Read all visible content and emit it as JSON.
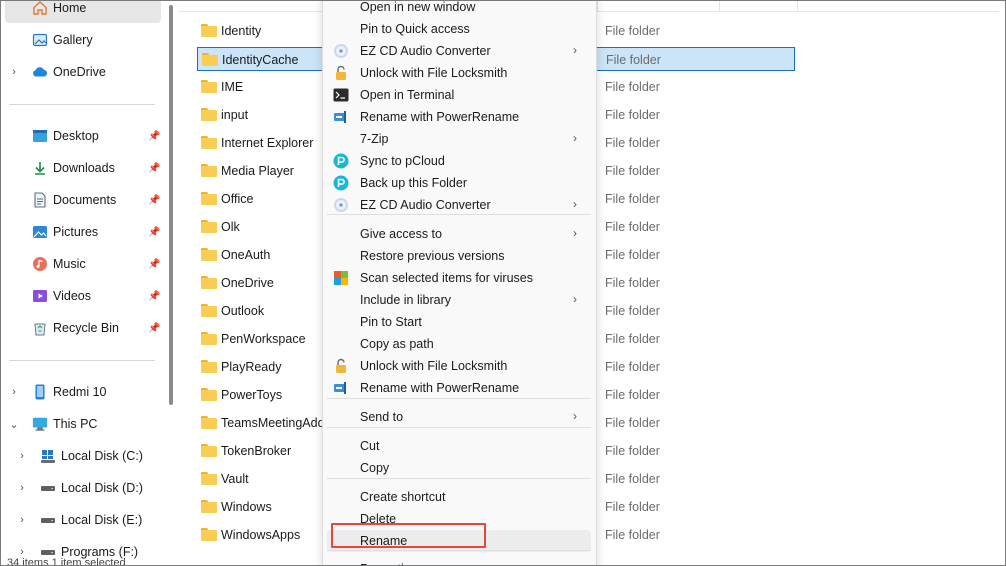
{
  "nav": {
    "home": "Home",
    "gallery": "Gallery",
    "onedrive": "OneDrive",
    "quick_access": [
      "Desktop",
      "Downloads",
      "Documents",
      "Pictures",
      "Music",
      "Videos",
      "Recycle Bin"
    ],
    "devices": {
      "redmi": "Redmi 10",
      "thispc": "This PC",
      "disks": [
        "Local Disk (C:)",
        "Local Disk (D:)",
        "Local Disk (E:)",
        "Programs (F:)"
      ]
    }
  },
  "files": {
    "names": [
      "Identity",
      "IdentityCache",
      "IME",
      "input",
      "Internet Explorer",
      "Media Player",
      "Office",
      "Olk",
      "OneAuth",
      "OneDrive",
      "Outlook",
      "PenWorkspace",
      "PlayReady",
      "PowerToys",
      "TeamsMeetingAdd-",
      "TokenBroker",
      "Vault",
      "Windows",
      "WindowsApps"
    ],
    "type_label": "File folder",
    "selected": "IdentityCache"
  },
  "status": "34 items    1 item selected",
  "menu": {
    "items": [
      {
        "label": "Open in new window",
        "icon": ""
      },
      {
        "label": "Pin to Quick access",
        "icon": ""
      },
      {
        "label": "EZ CD Audio Converter",
        "icon": "ezcd-icon",
        "submenu": true
      },
      {
        "label": "Unlock with File Locksmith",
        "icon": "lock-icon"
      },
      {
        "label": "Open in Terminal",
        "icon": "terminal-icon"
      },
      {
        "label": "Rename with PowerRename",
        "icon": "powerrename-icon"
      },
      {
        "label": "7-Zip",
        "icon": "",
        "submenu": true
      },
      {
        "label": "Sync to pCloud",
        "icon": "pcloud-icon"
      },
      {
        "label": "Back up this Folder",
        "icon": "pcloud-icon"
      },
      {
        "label": "EZ CD Audio Converter",
        "icon": "ezcd-icon",
        "submenu": true
      },
      {
        "label": "Give access to",
        "icon": "",
        "submenu": true
      },
      {
        "label": "Restore previous versions",
        "icon": ""
      },
      {
        "label": "Scan selected items for viruses",
        "icon": "antivirus-icon"
      },
      {
        "label": "Include in library",
        "icon": "",
        "submenu": true
      },
      {
        "label": "Pin to Start",
        "icon": ""
      },
      {
        "label": "Copy as path",
        "icon": ""
      },
      {
        "label": "Unlock with File Locksmith",
        "icon": "lock-icon"
      },
      {
        "label": "Rename with PowerRename",
        "icon": "powerrename-icon"
      },
      {
        "label": "Send to",
        "icon": "",
        "submenu": true
      },
      {
        "label": "Cut",
        "icon": ""
      },
      {
        "label": "Copy",
        "icon": ""
      },
      {
        "label": "Create shortcut",
        "icon": ""
      },
      {
        "label": "Delete",
        "icon": ""
      },
      {
        "label": "Rename",
        "icon": ""
      },
      {
        "label": "Properties",
        "icon": ""
      }
    ],
    "highlighted": "Rename",
    "highlight_color": "#e0493b"
  },
  "colors": {
    "selection_bg": "#cce4f7",
    "selection_border": "#1b6ec2",
    "folder": "#f8cd52"
  }
}
